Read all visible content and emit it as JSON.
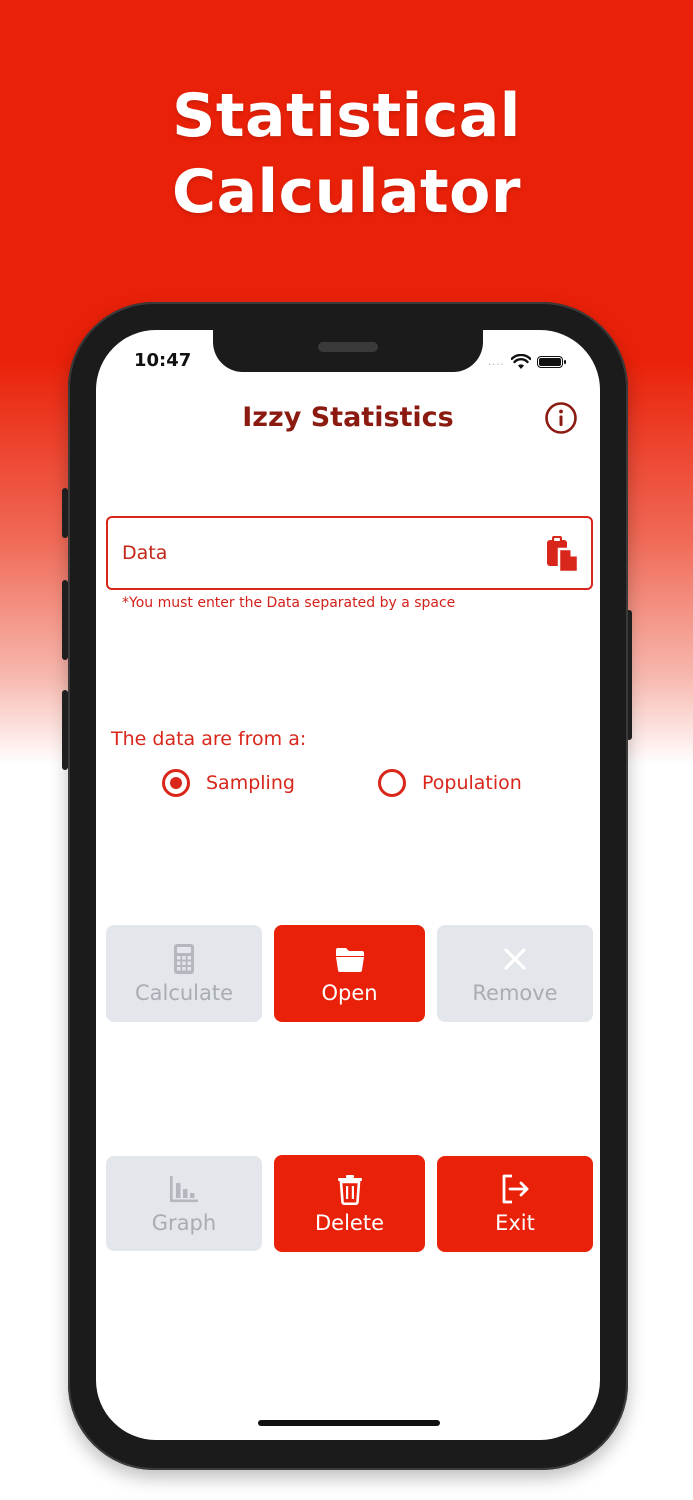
{
  "promo": {
    "title_line1": "Statistical",
    "title_line2": "Calculator"
  },
  "status_bar": {
    "time": "10:47",
    "signal": "....",
    "wifi_icon": "wifi-icon",
    "battery_icon": "battery-icon"
  },
  "header": {
    "title": "Izzy Statistics",
    "info_icon": "info-icon"
  },
  "data_input": {
    "label": "Data",
    "value": "",
    "paste_icon": "paste-icon",
    "helper": "*You must enter the Data separated by a space"
  },
  "source": {
    "heading": "The data are from a:",
    "options": [
      {
        "label": "Sampling",
        "selected": true
      },
      {
        "label": "Population",
        "selected": false
      }
    ]
  },
  "buttons": {
    "calculate": {
      "label": "Calculate",
      "icon": "calculator-icon",
      "enabled": false
    },
    "open": {
      "label": "Open",
      "icon": "folder-icon",
      "enabled": true
    },
    "remove": {
      "label": "Remove",
      "icon": "close-icon",
      "enabled": false
    },
    "graph": {
      "label": "Graph",
      "icon": "bar-chart-icon",
      "enabled": false
    },
    "delete": {
      "label": "Delete",
      "icon": "trash-icon",
      "enabled": true
    },
    "exit": {
      "label": "Exit",
      "icon": "exit-icon",
      "enabled": true
    }
  },
  "colors": {
    "brand_red": "#ea2109",
    "title_dark_red": "#8b1a10",
    "accent_red": "#d8261a",
    "disabled_bg": "#e3e6ea",
    "disabled_text": "#a9adb3"
  }
}
